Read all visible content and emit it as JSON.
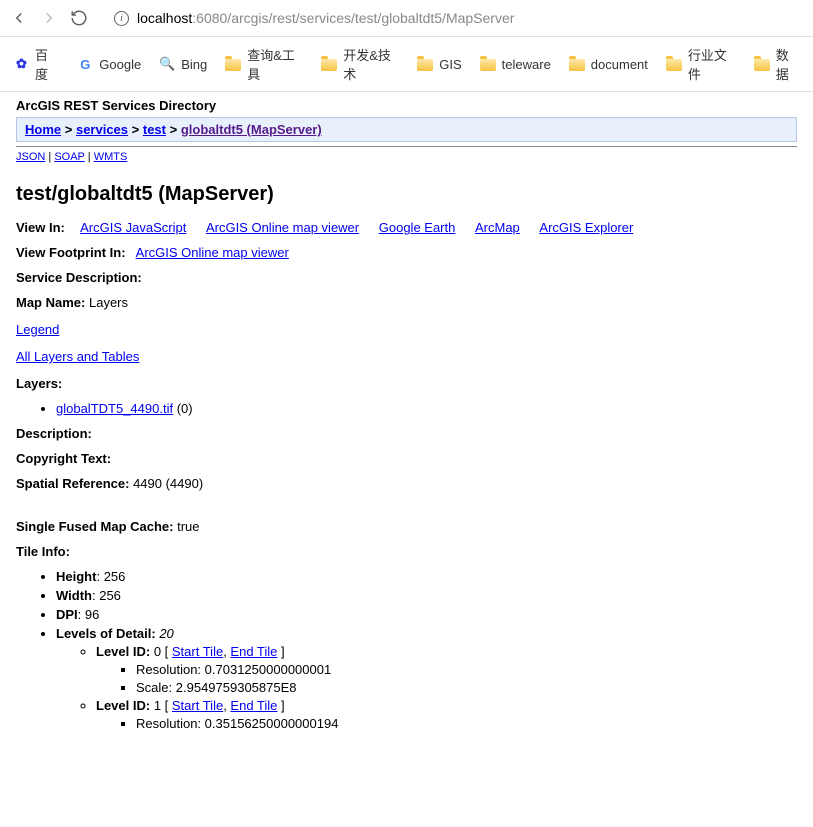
{
  "browser": {
    "url_host": "localhost",
    "url_rest": ":6080/arcgis/rest/services/test/globaltdt5/MapServer",
    "bookmarks": [
      {
        "label": "百度",
        "icon": "baidu"
      },
      {
        "label": "Google",
        "icon": "google"
      },
      {
        "label": "Bing",
        "icon": "bing"
      },
      {
        "label": "查询&工具",
        "icon": "folder"
      },
      {
        "label": "开发&技术",
        "icon": "folder"
      },
      {
        "label": "GIS",
        "icon": "folder"
      },
      {
        "label": "teleware",
        "icon": "folder"
      },
      {
        "label": "document",
        "icon": "folder"
      },
      {
        "label": "行业文件",
        "icon": "folder"
      },
      {
        "label": "数据",
        "icon": "folder"
      }
    ]
  },
  "header": {
    "directory_title": "ArcGIS REST Services Directory",
    "breadcrumb": {
      "home": "Home",
      "services": "services",
      "folder": "test",
      "service": "globaltdt5 (MapServer)",
      "sep": ">"
    },
    "formats": {
      "json": "JSON",
      "soap": "SOAP",
      "wmts": "WMTS",
      "sep": " | "
    }
  },
  "page_title": "test/globaltdt5 (MapServer)",
  "labels": {
    "view_in": "View In:",
    "view_footprint_in": "View Footprint In:",
    "service_description": "Service Description:",
    "map_name": "Map Name:",
    "legend": "Legend",
    "all_layers": "All Layers and Tables",
    "layers": "Layers:",
    "description": "Description:",
    "copyright": "Copyright Text:",
    "spatial_ref": "Spatial Reference:",
    "single_fused": "Single Fused Map Cache:",
    "tile_info": "Tile Info:",
    "height": "Height",
    "width": "Width",
    "dpi": "DPI",
    "lod": "Levels of Detail:",
    "level_id": "Level ID:",
    "start_tile": "Start Tile",
    "end_tile": "End Tile",
    "resolution": "Resolution:",
    "scale": "Scale:"
  },
  "view_in_links": [
    "ArcGIS JavaScript",
    "ArcGIS Online map viewer",
    "Google Earth",
    "ArcMap",
    "ArcGIS Explorer"
  ],
  "footprint_link": "ArcGIS Online map viewer",
  "values": {
    "map_name": "Layers",
    "spatial_ref": "4490  (4490)",
    "single_fused": "true",
    "height": "256",
    "width": "256",
    "dpi": "96",
    "lod_count": "20"
  },
  "layers_list": [
    {
      "name": "globalTDT5_4490.tif",
      "suffix": "(0)"
    }
  ],
  "levels": [
    {
      "id": "0",
      "resolution": "0.7031250000000001",
      "scale": "2.9549759305875E8"
    },
    {
      "id": "1",
      "resolution": "0.35156250000000194",
      "scale": ""
    }
  ]
}
